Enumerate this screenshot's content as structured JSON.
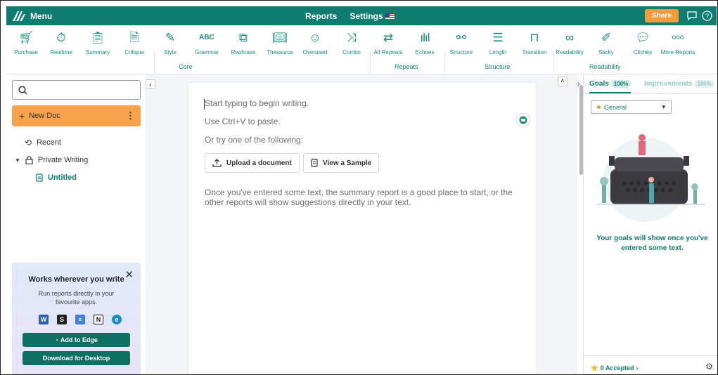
{
  "topbar": {
    "menu_label": "Menu",
    "nav": [
      "Reports",
      "Settings"
    ],
    "share_label": "Share"
  },
  "toolbar": {
    "tools": [
      {
        "label": "Purchase",
        "icon": "cart-icon"
      },
      {
        "label": "Realtime",
        "icon": "stopwatch-icon"
      },
      {
        "label": "Summary",
        "icon": "clipboard-icon"
      },
      {
        "label": "Critique",
        "icon": "critique-icon"
      },
      {
        "label": "Style",
        "icon": "pen-icon"
      },
      {
        "label": "Grammar",
        "icon": "abc-icon"
      },
      {
        "label": "Rephrase",
        "icon": "rephrase-icon"
      },
      {
        "label": "Thesaurus",
        "icon": "book-icon"
      },
      {
        "label": "Overused",
        "icon": "face-icon"
      },
      {
        "label": "Combo",
        "icon": "shuffle-icon"
      },
      {
        "label": "All Repeats",
        "icon": "repeat-icon"
      },
      {
        "label": "Echoes",
        "icon": "soundwave-icon"
      },
      {
        "label": "Structure",
        "icon": "structure-icon"
      },
      {
        "label": "Length",
        "icon": "length-icon"
      },
      {
        "label": "Transition",
        "icon": "transition-icon"
      },
      {
        "label": "Readability",
        "icon": "glasses-icon"
      },
      {
        "label": "Sticky",
        "icon": "sticky-icon"
      },
      {
        "label": "Clichés",
        "icon": "speech-icon"
      },
      {
        "label": "More Reports",
        "icon": "more-icon"
      }
    ],
    "groups": [
      "Core",
      "Repeats",
      "Structure",
      "Readability"
    ]
  },
  "sidebar": {
    "new_doc": "New Doc",
    "recent": "Recent",
    "private_writing": "Private Writing",
    "untitled": "Untitled",
    "promo": {
      "title": "Works wherever you write",
      "desc": "Run reports directly in your favourite apps.",
      "add_edge": "Add to Edge",
      "download": "Download for Desktop"
    }
  },
  "editor": {
    "placeholder_1": "Start typing to begin writing.",
    "placeholder_2": "Use Ctrl+V to paste.",
    "placeholder_3": "Or try one of the following:",
    "upload_label": "Upload a document",
    "sample_label": "View a Sample",
    "hint": "Once you've entered some text, the summary report is a good place to start, or the other reports will show suggestions directly in your text."
  },
  "right_panel": {
    "goals_tab": "Goals",
    "goals_pct": "100%",
    "improvements_tab": "Improvements",
    "improvements_pct": "100%",
    "goal_select": "General",
    "message": "Your goals will show once you've entered some text.",
    "accepted": "0 Accepted"
  },
  "colors": {
    "brand": "#0e7d6f",
    "accent": "#f39b3a"
  }
}
